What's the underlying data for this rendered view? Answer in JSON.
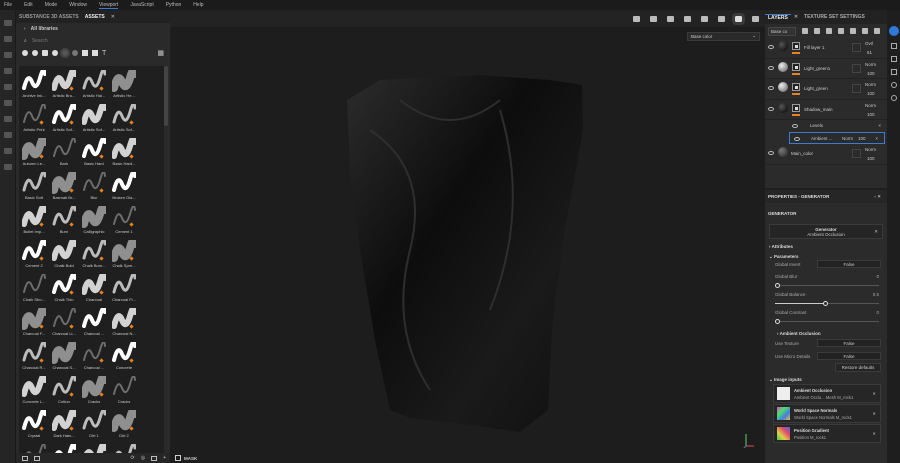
{
  "menu": [
    "File",
    "Edit",
    "Mode",
    "Window",
    "Viewport",
    "JavaScript",
    "Python",
    "Help"
  ],
  "assets": {
    "tabs": [
      "SUBSTANCE 3D ASSETS",
      "ASSETS"
    ],
    "libraries": "All libraries",
    "search_placeholder": "Search",
    "items": [
      "Archive Ink...",
      "Artistic Bru...",
      "Artistic Hai...",
      "Artistic He...",
      "Artistic Print",
      "Artistic Sof...",
      "Artistic Sof...",
      "Artistic Sof...",
      "Autumn Le...",
      "Bark",
      "Basic Hard",
      "Basic Hard...",
      "Basic Soft",
      "Basmati Br...",
      "Blur",
      "Broken Gla...",
      "Bullet Imp...",
      "Burn",
      "Calligraphic",
      "Cement 1",
      "Cement 2",
      "Chalk Bold",
      "Chalk Bum...",
      "Chalk Spre...",
      "Chalk Stro...",
      "Chalk Thin",
      "Charcoal",
      "Charcoal Fi...",
      "Charcoal F...",
      "Charcoal Li...",
      "Charcoal ...",
      "Charcoal N...",
      "Charcoal R...",
      "Charcoal S...",
      "Charcoal ...",
      "Concrete",
      "Concrete L...",
      "Cotton",
      "Cracks",
      "Cracks",
      "Crystal",
      "Dark Hatc...",
      "Dirt 1",
      "Dirt 2"
    ]
  },
  "viewport": {
    "channel": "Base color",
    "mask_label": "MASK"
  },
  "layers": {
    "tabs": [
      "LAYERS",
      "TEXTURE SET SETTINGS"
    ],
    "channel": "Base co",
    "items": [
      {
        "name": "Fill layer 1",
        "blend": "Ovrl",
        "opacity": "61"
      },
      {
        "name": "Light_green1",
        "blend": "Norm",
        "opacity": "100"
      },
      {
        "name": "Light_green",
        "blend": "Norm",
        "opacity": "100"
      },
      {
        "name": "Shadow_main",
        "blend": "Norm",
        "opacity": "100"
      }
    ],
    "effects": [
      {
        "name": "Levels"
      },
      {
        "name": "Ambient ...",
        "blend": "Norm",
        "opacity": "100"
      }
    ],
    "main": {
      "name": "Main_color",
      "blend": "Norm",
      "opacity": "100"
    }
  },
  "properties": {
    "header": "PROPERTIES - GENERATOR",
    "title": "GENERATOR",
    "gen_name": "Generator",
    "gen_sub": "Ambient Occlusion",
    "attributes": "Attributes",
    "parameters": "Parameters",
    "global_invert": {
      "label": "Global Invert",
      "value": "False"
    },
    "global_blur": {
      "label": "Global Blur",
      "value": "0"
    },
    "global_balance": {
      "label": "Global Balance",
      "value": "0.5"
    },
    "global_contrast": {
      "label": "Global Contrast",
      "value": "0"
    },
    "ao_section": "Ambient Occlusion",
    "use_texture": {
      "label": "Use Texture",
      "value": "False"
    },
    "use_micro": {
      "label": "Use Micro Details",
      "value": "False"
    },
    "restore": "Restore defaults",
    "image_inputs": "Image inputs",
    "inputs": [
      {
        "title": "Ambient Occlusion",
        "sub": "Ambient Occlu... Mesh M_rock1"
      },
      {
        "title": "World Space Normals",
        "sub": "World Space Normals M_rock1"
      },
      {
        "title": "Position Gradient",
        "sub": "Position M_rock1"
      }
    ]
  }
}
